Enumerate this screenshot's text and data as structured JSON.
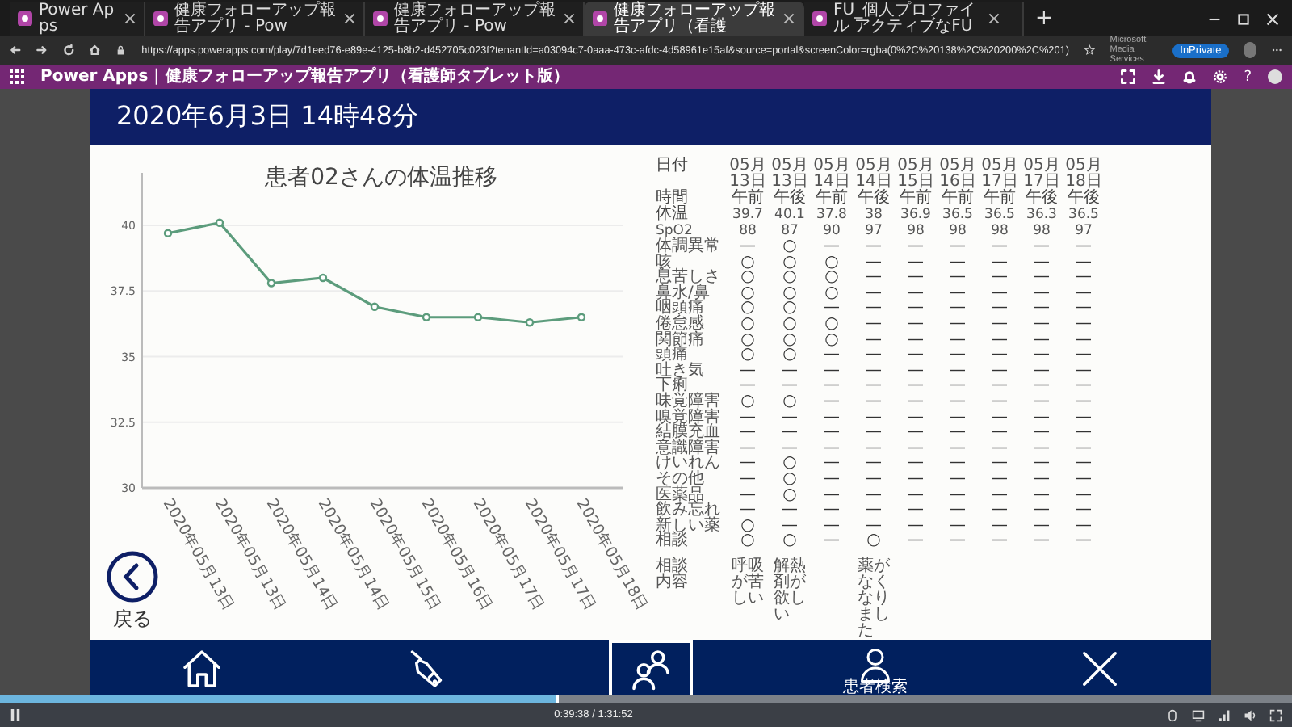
{
  "browser": {
    "tabs": [
      {
        "title": "Power Apps",
        "selected": false
      },
      {
        "title": "健康フォローアップ報告アプリ - Pow",
        "selected": false
      },
      {
        "title": "健康フォローアップ報告アプリ - Pow",
        "selected": false
      },
      {
        "title": "健康フォローアップ報告アプリ（看護",
        "selected": true
      },
      {
        "title": "FU_個人プロファイル アクティブなFU",
        "selected": false
      }
    ],
    "new_tab": "+",
    "url": "https://apps.powerapps.com/play/7d1eed76-e89e-4125-b8b2-d452705c023f?tenantId=a03094c7-0aaa-473c-afdc-4d58961e15af&source=portal&screenColor=rgba(0%2C%20138%2C%20200%2C%201)",
    "profile_org": "Microsoft Media Services",
    "profile_badge": "InPrivate"
  },
  "app_bar": {
    "title": "Power Apps | 健康フォローアップ報告アプリ（看護師タブレット版）",
    "help": "?"
  },
  "header": {
    "datetime": "2020年6月3日 14時48分"
  },
  "chart": {
    "chart_data": {
      "type": "line",
      "title": "患者02さんの体温推移",
      "categories": [
        "2020年05月13日",
        "2020年05月13日",
        "2020年05月14日",
        "2020年05月14日",
        "2020年05月15日",
        "2020年05月16日",
        "2020年05月17日",
        "2020年05月17日",
        "2020年05月18日"
      ],
      "series": [
        {
          "color": "#5c9c7c",
          "marker": "circle",
          "values": [
            39.7,
            40.1,
            37.8,
            38,
            36.9,
            36.5,
            36.5,
            36.3,
            36.5
          ]
        }
      ],
      "grid": true,
      "ylim": [
        30,
        42
      ],
      "yticks": [
        30,
        {
          "value": 32.5,
          "label": "32.5"
        },
        35,
        {
          "value": 37.5,
          "label": "37.5"
        },
        40
      ]
    }
  },
  "table": {
    "date_label": "日付",
    "time_label": "時間",
    "temp_label": "体温",
    "spo2_label": "SpO2",
    "note_label": "相談内容",
    "columns": [
      {
        "month": "05月",
        "day": "13日",
        "time": "午前",
        "temp": "39.7",
        "spo2": "88",
        "note": "呼吸が苦しい"
      },
      {
        "month": "05月",
        "day": "13日",
        "time": "午後",
        "temp": "40.1",
        "spo2": "87",
        "note": "解熱剤が欲しい"
      },
      {
        "month": "05月",
        "day": "14日",
        "time": "午前",
        "temp": "37.8",
        "spo2": "90"
      },
      {
        "month": "05月",
        "day": "14日",
        "time": "午後",
        "temp": "38",
        "spo2": "97",
        "note": "薬がなくなりました"
      },
      {
        "month": "05月",
        "day": "15日",
        "time": "午前",
        "temp": "36.9",
        "spo2": "98"
      },
      {
        "month": "05月",
        "day": "16日",
        "time": "午前",
        "temp": "36.5",
        "spo2": "98"
      },
      {
        "month": "05月",
        "day": "17日",
        "time": "午前",
        "temp": "36.5",
        "spo2": "98"
      },
      {
        "month": "05月",
        "day": "17日",
        "time": "午後",
        "temp": "36.3",
        "spo2": "98"
      },
      {
        "month": "05月",
        "day": "18日",
        "time": "午後",
        "temp": "36.5",
        "spo2": "97"
      }
    ],
    "symptoms": [
      {
        "label": "体調異常",
        "marks": [
          "—",
          "○",
          "—",
          "—",
          "—",
          "—",
          "—",
          "—",
          "—"
        ]
      },
      {
        "label": "咳",
        "marks": [
          "○",
          "○",
          "○",
          "—",
          "—",
          "—",
          "—",
          "—",
          "—"
        ]
      },
      {
        "label": "息苦しさ",
        "marks": [
          "○",
          "○",
          "○",
          "—",
          "—",
          "—",
          "—",
          "—",
          "—"
        ]
      },
      {
        "label": "鼻水/鼻",
        "marks": [
          "○",
          "○",
          "○",
          "—",
          "—",
          "—",
          "—",
          "—",
          "—"
        ]
      },
      {
        "label": "咽頭痛",
        "marks": [
          "○",
          "○",
          "—",
          "—",
          "—",
          "—",
          "—",
          "—",
          "—"
        ]
      },
      {
        "label": "倦怠感",
        "marks": [
          "○",
          "○",
          "○",
          "—",
          "—",
          "—",
          "—",
          "—",
          "—"
        ]
      },
      {
        "label": "関節痛",
        "marks": [
          "○",
          "○",
          "○",
          "—",
          "—",
          "—",
          "—",
          "—",
          "—"
        ]
      },
      {
        "label": "頭痛",
        "marks": [
          "○",
          "○",
          "—",
          "—",
          "—",
          "—",
          "—",
          "—",
          "—"
        ]
      },
      {
        "label": "吐き気",
        "marks": [
          "—",
          "—",
          "—",
          "—",
          "—",
          "—",
          "—",
          "—",
          "—"
        ]
      },
      {
        "label": "下痢",
        "marks": [
          "—",
          "—",
          "—",
          "—",
          "—",
          "—",
          "—",
          "—",
          "—"
        ]
      },
      {
        "label": "味覚障害",
        "marks": [
          "○",
          "○",
          "—",
          "—",
          "—",
          "—",
          "—",
          "—",
          "—"
        ]
      },
      {
        "label": "嗅覚障害",
        "marks": [
          "—",
          "—",
          "—",
          "—",
          "—",
          "—",
          "—",
          "—",
          "—"
        ]
      },
      {
        "label": "結膜充血",
        "marks": [
          "—",
          "—",
          "—",
          "—",
          "—",
          "—",
          "—",
          "—",
          "—"
        ]
      },
      {
        "label": "意識障害",
        "marks": [
          "—",
          "—",
          "—",
          "—",
          "—",
          "—",
          "—",
          "—",
          "—"
        ]
      },
      {
        "label": "けいれん",
        "marks": [
          "—",
          "○",
          "—",
          "—",
          "—",
          "—",
          "—",
          "—",
          "—"
        ]
      },
      {
        "label": "その他",
        "marks": [
          "—",
          "○",
          "—",
          "—",
          "—",
          "—",
          "—",
          "—",
          "—"
        ]
      },
      {
        "label": "医薬品",
        "marks": [
          "—",
          "○",
          "—",
          "—",
          "—",
          "—",
          "—",
          "—",
          "—"
        ]
      },
      {
        "label": "飲み忘れ",
        "marks": [
          "—",
          "—",
          "—",
          "—",
          "—",
          "—",
          "—",
          "—",
          "—"
        ]
      },
      {
        "label": "新しい薬",
        "marks": [
          "○",
          "—",
          "—",
          "—",
          "—",
          "—",
          "—",
          "—",
          "—"
        ]
      },
      {
        "label": "相談",
        "marks": [
          "○",
          "○",
          "—",
          "○",
          "—",
          "—",
          "—",
          "—",
          "—"
        ]
      }
    ]
  },
  "back_button": {
    "label": "戻る"
  },
  "nav": [
    {
      "kind": "home",
      "selected": false
    },
    {
      "kind": "pen",
      "selected": false
    },
    {
      "kind": "people",
      "selected": true
    },
    {
      "kind": "person",
      "label": "患者検索",
      "selected": false
    },
    {
      "kind": "close",
      "selected": false
    }
  ],
  "video": {
    "level": 0.43,
    "time": "0:39:38 / 1:31:52"
  }
}
